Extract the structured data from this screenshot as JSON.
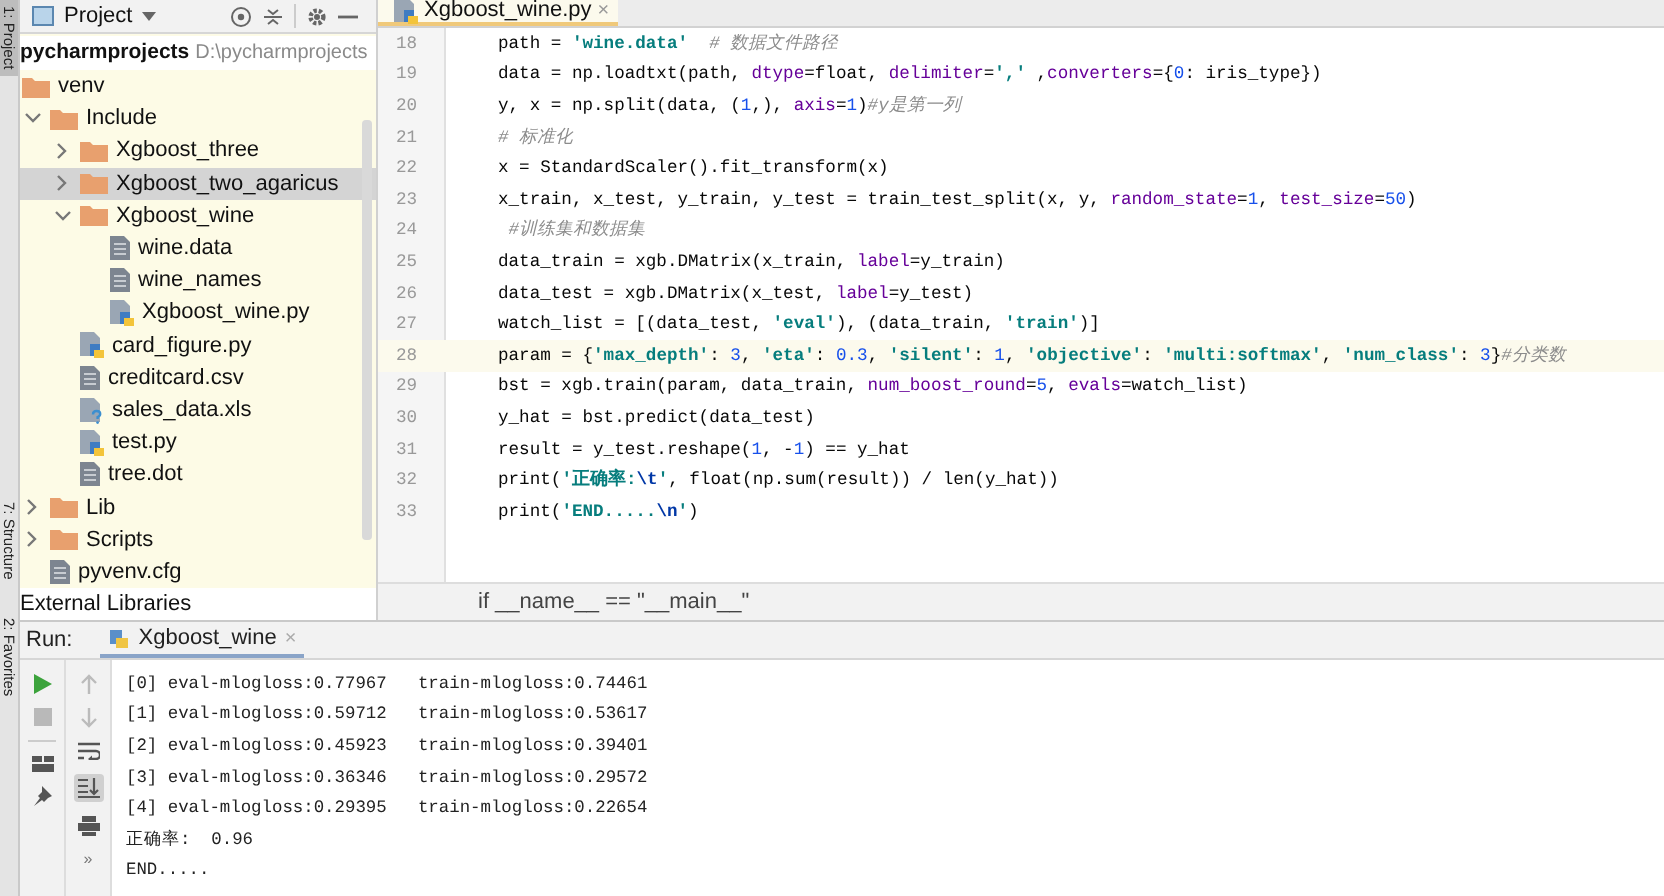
{
  "side_strip": {
    "tabs": [
      {
        "label": "1: Project",
        "selected": true
      },
      {
        "label": "7: Structure",
        "selected": false
      },
      {
        "label": "2: Favorites",
        "selected": false
      }
    ]
  },
  "project_panel": {
    "title": "Project",
    "root": {
      "name": "pycharmprojects",
      "path": "D:\\pycharmprojects"
    },
    "tree": [
      {
        "name": "venv",
        "kind": "folder",
        "selected": false,
        "children": [
          {
            "name": "Include",
            "kind": "folder",
            "expanded": true,
            "selected": false,
            "children": [
              {
                "name": "Xgboost_three",
                "kind": "folder",
                "expanded": false,
                "selected": false
              },
              {
                "name": "Xgboost_two_agaricus",
                "kind": "folder",
                "expanded": false,
                "selected": true
              },
              {
                "name": "Xgboost_wine",
                "kind": "folder",
                "expanded": true,
                "selected": false,
                "children": [
                  {
                    "name": "wine.data",
                    "kind": "file",
                    "selected": false
                  },
                  {
                    "name": "wine_names",
                    "kind": "file",
                    "selected": false
                  },
                  {
                    "name": "Xgboost_wine.py",
                    "kind": "python",
                    "selected": false
                  }
                ]
              },
              {
                "name": "card_figure.py",
                "kind": "python",
                "selected": false
              },
              {
                "name": "creditcard.csv",
                "kind": "file",
                "selected": false
              },
              {
                "name": "sales_data.xls",
                "kind": "unknown",
                "selected": false
              },
              {
                "name": "test.py",
                "kind": "python",
                "selected": false
              },
              {
                "name": "tree.dot",
                "kind": "file",
                "selected": false
              }
            ]
          },
          {
            "name": "Lib",
            "kind": "folder",
            "expanded": false,
            "selected": false
          },
          {
            "name": "Scripts",
            "kind": "folder",
            "expanded": false,
            "selected": false
          },
          {
            "name": "pyvenv.cfg",
            "kind": "file",
            "selected": false
          }
        ]
      }
    ],
    "external": "External Libraries"
  },
  "editor": {
    "tab": {
      "label": "Xgboost_wine.py",
      "close": "×"
    },
    "lines": [
      {
        "number": "18",
        "current": false,
        "segments": [
          {
            "kind": "plain",
            "text": "path = "
          },
          {
            "kind": "string",
            "text": "'wine.data'"
          },
          {
            "kind": "comment",
            "text": "  # 数据文件路径"
          }
        ]
      },
      {
        "number": "19",
        "current": false,
        "segments": [
          {
            "kind": "plain",
            "text": "data = np.loadtxt(path, "
          },
          {
            "kind": "kwarg",
            "text": "dtype"
          },
          {
            "kind": "plain",
            "text": "=float, "
          },
          {
            "kind": "kwarg",
            "text": "delimiter"
          },
          {
            "kind": "plain",
            "text": "="
          },
          {
            "kind": "string",
            "text": "','"
          },
          {
            "kind": "plain",
            "text": " ,"
          },
          {
            "kind": "kwarg",
            "text": "converters"
          },
          {
            "kind": "plain",
            "text": "={"
          },
          {
            "kind": "number",
            "text": "0"
          },
          {
            "kind": "plain",
            "text": ": iris_type})"
          }
        ]
      },
      {
        "number": "20",
        "current": false,
        "segments": [
          {
            "kind": "plain",
            "text": "y, x = np.split(data, ("
          },
          {
            "kind": "number",
            "text": "1"
          },
          {
            "kind": "plain",
            "text": ",), "
          },
          {
            "kind": "kwarg",
            "text": "axis"
          },
          {
            "kind": "plain",
            "text": "="
          },
          {
            "kind": "number",
            "text": "1"
          },
          {
            "kind": "plain",
            "text": ")"
          },
          {
            "kind": "comment",
            "text": "#y是第一列"
          }
        ]
      },
      {
        "number": "21",
        "current": false,
        "segments": [
          {
            "kind": "comment",
            "text": "# 标准化"
          }
        ]
      },
      {
        "number": "22",
        "current": false,
        "segments": [
          {
            "kind": "plain",
            "text": "x = StandardScaler().fit_transform(x)"
          }
        ]
      },
      {
        "number": "23",
        "current": false,
        "segments": [
          {
            "kind": "plain",
            "text": "x_train, x_test, y_train, y_test = train_test_split(x, y, "
          },
          {
            "kind": "kwarg",
            "text": "random_state"
          },
          {
            "kind": "plain",
            "text": "="
          },
          {
            "kind": "number",
            "text": "1"
          },
          {
            "kind": "plain",
            "text": ", "
          },
          {
            "kind": "kwarg",
            "text": "test_size"
          },
          {
            "kind": "plain",
            "text": "="
          },
          {
            "kind": "number",
            "text": "50"
          },
          {
            "kind": "plain",
            "text": ")"
          }
        ]
      },
      {
        "number": "24",
        "current": false,
        "segments": [
          {
            "kind": "comment",
            "text": " #训练集和数据集"
          }
        ]
      },
      {
        "number": "25",
        "current": false,
        "segments": [
          {
            "kind": "plain",
            "text": "data_train = xgb.DMatrix(x_train, "
          },
          {
            "kind": "kwarg",
            "text": "label"
          },
          {
            "kind": "plain",
            "text": "=y_train)"
          }
        ]
      },
      {
        "number": "26",
        "current": false,
        "segments": [
          {
            "kind": "plain",
            "text": "data_test = xgb.DMatrix(x_test, "
          },
          {
            "kind": "kwarg",
            "text": "label"
          },
          {
            "kind": "plain",
            "text": "=y_test)"
          }
        ]
      },
      {
        "number": "27",
        "current": false,
        "segments": [
          {
            "kind": "plain",
            "text": "watch_list = [(data_test, "
          },
          {
            "kind": "string",
            "text": "'eval'"
          },
          {
            "kind": "plain",
            "text": "), (data_train, "
          },
          {
            "kind": "string",
            "text": "'train'"
          },
          {
            "kind": "plain",
            "text": ")]"
          }
        ]
      },
      {
        "number": "28",
        "current": true,
        "segments": [
          {
            "kind": "plain",
            "text": "param = {"
          },
          {
            "kind": "string",
            "text": "'max_depth'"
          },
          {
            "kind": "plain",
            "text": ": "
          },
          {
            "kind": "number",
            "text": "3"
          },
          {
            "kind": "plain",
            "text": ", "
          },
          {
            "kind": "string",
            "text": "'eta'"
          },
          {
            "kind": "plain",
            "text": ": "
          },
          {
            "kind": "number",
            "text": "0.3"
          },
          {
            "kind": "plain",
            "text": ", "
          },
          {
            "kind": "string",
            "text": "'silent'"
          },
          {
            "kind": "plain",
            "text": ": "
          },
          {
            "kind": "number",
            "text": "1"
          },
          {
            "kind": "plain",
            "text": ", "
          },
          {
            "kind": "string",
            "text": "'objective'"
          },
          {
            "kind": "plain",
            "text": ": "
          },
          {
            "kind": "string",
            "text": "'multi:softmax'"
          },
          {
            "kind": "plain",
            "text": ", "
          },
          {
            "kind": "string",
            "text": "'num_class'"
          },
          {
            "kind": "plain",
            "text": ": "
          },
          {
            "kind": "number",
            "text": "3"
          },
          {
            "kind": "plain",
            "text": "}"
          },
          {
            "kind": "comment",
            "text": "#分类数"
          }
        ]
      },
      {
        "number": "29",
        "current": false,
        "segments": [
          {
            "kind": "plain",
            "text": "bst = xgb.train(param, data_train, "
          },
          {
            "kind": "kwarg",
            "text": "num_boost_round"
          },
          {
            "kind": "plain",
            "text": "="
          },
          {
            "kind": "number",
            "text": "5"
          },
          {
            "kind": "plain",
            "text": ", "
          },
          {
            "kind": "kwarg",
            "text": "evals"
          },
          {
            "kind": "plain",
            "text": "=watch_list)"
          }
        ]
      },
      {
        "number": "30",
        "current": false,
        "segments": [
          {
            "kind": "plain",
            "text": "y_hat = bst.predict(data_test)"
          }
        ]
      },
      {
        "number": "31",
        "current": false,
        "segments": [
          {
            "kind": "plain",
            "text": "result = y_test.reshape("
          },
          {
            "kind": "number",
            "text": "1"
          },
          {
            "kind": "plain",
            "text": ", -"
          },
          {
            "kind": "number",
            "text": "1"
          },
          {
            "kind": "plain",
            "text": ") == y_hat"
          }
        ]
      },
      {
        "number": "32",
        "current": false,
        "segments": [
          {
            "kind": "plain",
            "text": "print("
          },
          {
            "kind": "string",
            "text": "'正确率:"
          },
          {
            "kind": "escape",
            "text": "\\t"
          },
          {
            "kind": "string",
            "text": "'"
          },
          {
            "kind": "plain",
            "text": ", float(np.sum(result)) / len(y_hat))"
          }
        ]
      },
      {
        "number": "33",
        "current": false,
        "segments": [
          {
            "kind": "plain",
            "text": "print("
          },
          {
            "kind": "string",
            "text": "'END....."
          },
          {
            "kind": "escape",
            "text": "\\n"
          },
          {
            "kind": "string",
            "text": "'"
          },
          {
            "kind": "plain",
            "text": ")"
          }
        ]
      }
    ],
    "breadcrumb": "if __name__ == \"__main__\""
  },
  "run_panel": {
    "label": "Run:",
    "tab": {
      "label": "Xgboost_wine",
      "close": "×"
    },
    "more": "»",
    "output": [
      "[0] eval-mlogloss:0.77967   train-mlogloss:0.74461",
      "[1] eval-mlogloss:0.59712   train-mlogloss:0.53617",
      "[2] eval-mlogloss:0.45923   train-mlogloss:0.39401",
      "[3] eval-mlogloss:0.36346   train-mlogloss:0.29572",
      "[4] eval-mlogloss:0.29395   train-mlogloss:0.22654",
      "正确率:  0.96",
      "END....."
    ]
  }
}
